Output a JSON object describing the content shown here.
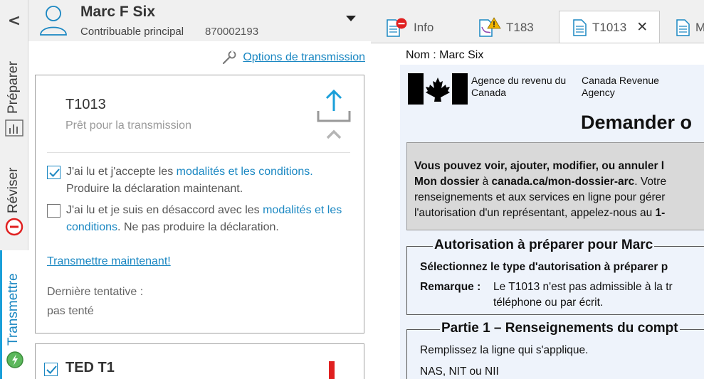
{
  "nav": {
    "collapse_glyph": "<",
    "tabs": [
      {
        "label": "Préparer",
        "icon": "bar-chart-icon",
        "active": false
      },
      {
        "label": "Réviser",
        "icon": "error-circle-icon",
        "active": false
      },
      {
        "label": "Transmettre",
        "icon": "transmit-check-icon",
        "active": true
      }
    ]
  },
  "taxpayer": {
    "name": "Marc F Six",
    "role": "Contribuable principal",
    "id": "870002193"
  },
  "options_link": "Options de transmission",
  "transmission_card": {
    "form": "T1013",
    "status": "Prêt pour la transmission",
    "accept": {
      "checked": true,
      "pre": "J'ai lu et j'accepte les ",
      "link": "modalités et les conditions.",
      "post": " Produire la déclaration maintenant."
    },
    "decline": {
      "checked": false,
      "pre": "J'ai lu et je suis en désaccord avec les ",
      "link": "modalités et les conditions",
      "post": ". Ne pas produire la déclaration."
    },
    "transmit_now": "Transmettre maintenant!",
    "last_attempt_label": "Dernière tentative :",
    "last_attempt_value": "pas tenté"
  },
  "second_card": {
    "title": "TED T1",
    "checked": true
  },
  "doc_tabs": [
    {
      "label": "Info",
      "icon": "document-error-icon"
    },
    {
      "label": "T183",
      "icon": "document-warning-icon"
    },
    {
      "label": "T1013",
      "icon": "document-icon",
      "active": true,
      "close": "✕"
    },
    {
      "label": "M",
      "icon": "document-icon"
    }
  ],
  "document": {
    "name_line": "Nom : Marc Six",
    "agency_fr": "Agence du revenu du Canada",
    "agency_en": "Canada Revenue Agency",
    "heading": "Demander o",
    "info_box": {
      "line1": "Vous pouvez voir, ajouter, modifier, ou annuler l",
      "line2_bold": "Mon dossier",
      "line2_mid": " à ",
      "line2_bold2": "canada.ca/mon-dossier-arc",
      "line2_rest": ". Votre",
      "line3": "renseignements et aux services en ligne pour gérer",
      "line4_pre": "l'autorisation d'un représentant, appelez-nous au ",
      "line4_bold": "1-"
    },
    "section_auth": {
      "title": "Autorisation à préparer pour Marc",
      "select": "Sélectionnez le type d'autorisation à préparer p",
      "note_label": "Remarque :",
      "note_line1": "Le T1013 n'est pas admissible à la tr",
      "note_line2": "téléphone ou par écrit."
    },
    "section_part1": {
      "title": "Partie 1 – Renseignements du compt",
      "instruction": "Remplissez la ligne qui s'applique.",
      "field": "NAS, NIT ou NII"
    }
  },
  "colors": {
    "accent": "#1a87c2",
    "error": "#e02020",
    "warning": "#f0b400"
  }
}
